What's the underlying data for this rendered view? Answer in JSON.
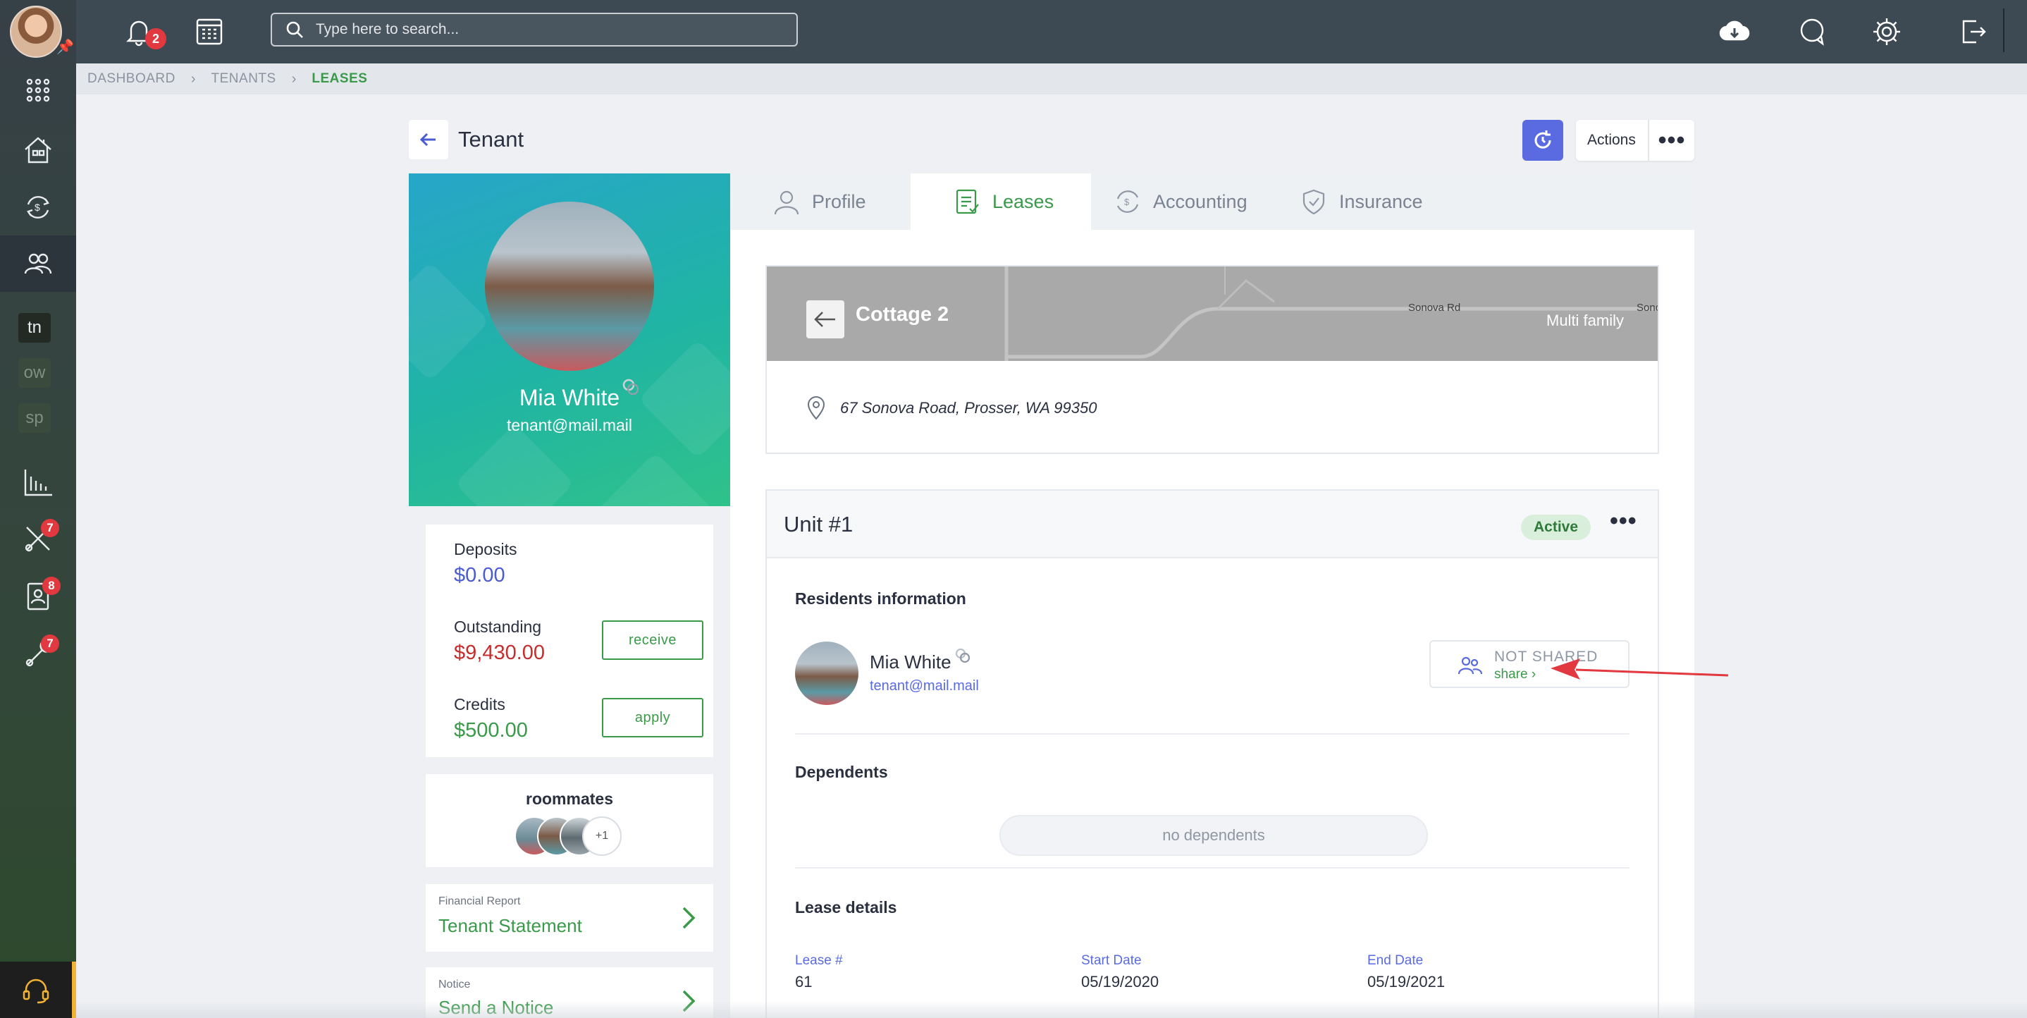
{
  "topbar": {
    "notifications_count": "2",
    "search_placeholder": "Type here to search..."
  },
  "sidebar": {
    "shortcuts": [
      "tn",
      "ow",
      "sp"
    ],
    "badges": {
      "tools": "7",
      "contacts": "8",
      "maintenance": "7"
    }
  },
  "breadcrumb": [
    "DASHBOARD",
    "TENANTS",
    "LEASES"
  ],
  "page": {
    "title": "Tenant",
    "actions_label": "Actions"
  },
  "profile": {
    "name": "Mia White",
    "email": "tenant@mail.mail"
  },
  "finances": {
    "deposits_label": "Deposits",
    "deposits_value": "$0.00",
    "outstanding_label": "Outstanding",
    "outstanding_value": "$9,430.00",
    "receive_label": "receive",
    "credits_label": "Credits",
    "credits_value": "$500.00",
    "apply_label": "apply",
    "colors": {
      "deposits": "#4b5bd1",
      "outstanding": "#c62d2d",
      "credits": "#3a9a4a"
    }
  },
  "roommates": {
    "title": "roommates",
    "more_label": "+1"
  },
  "links": [
    {
      "small": "Financial Report",
      "big": "Tenant Statement"
    },
    {
      "small": "Notice",
      "big": "Send a Notice"
    }
  ],
  "tabs": [
    {
      "label": "Profile",
      "icon": "user-icon",
      "active": false
    },
    {
      "label": "Leases",
      "icon": "lease-document-icon",
      "active": true
    },
    {
      "label": "Accounting",
      "icon": "accounting-cycle-icon",
      "active": false
    },
    {
      "label": "Insurance",
      "icon": "shield-check-icon",
      "active": false
    }
  ],
  "property": {
    "name": "Cottage 2",
    "type": "Multi family",
    "road_label": "Sonova Rd",
    "road_label_cut": "Sono",
    "address": "67 Sonova Road, Prosser, WA 99350"
  },
  "unit": {
    "title": "Unit #1",
    "status": "Active",
    "residents_title": "Residents information",
    "resident": {
      "name": "Mia White",
      "email": "tenant@mail.mail",
      "share_status": "NOT SHARED",
      "share_link": "share"
    },
    "dependents_title": "Dependents",
    "no_dependents": "no dependents",
    "lease_details_title": "Lease details",
    "lease_details": [
      {
        "label": "Lease #",
        "value": "61"
      },
      {
        "label": "Start Date",
        "value": "05/19/2020"
      },
      {
        "label": "End Date",
        "value": "05/19/2021"
      }
    ]
  },
  "colors": {
    "accent_green": "#3a9a4a",
    "accent_blue": "#5a6ae0",
    "topbar": "#3e4a53",
    "annotation_arrow": "#e2383f"
  }
}
